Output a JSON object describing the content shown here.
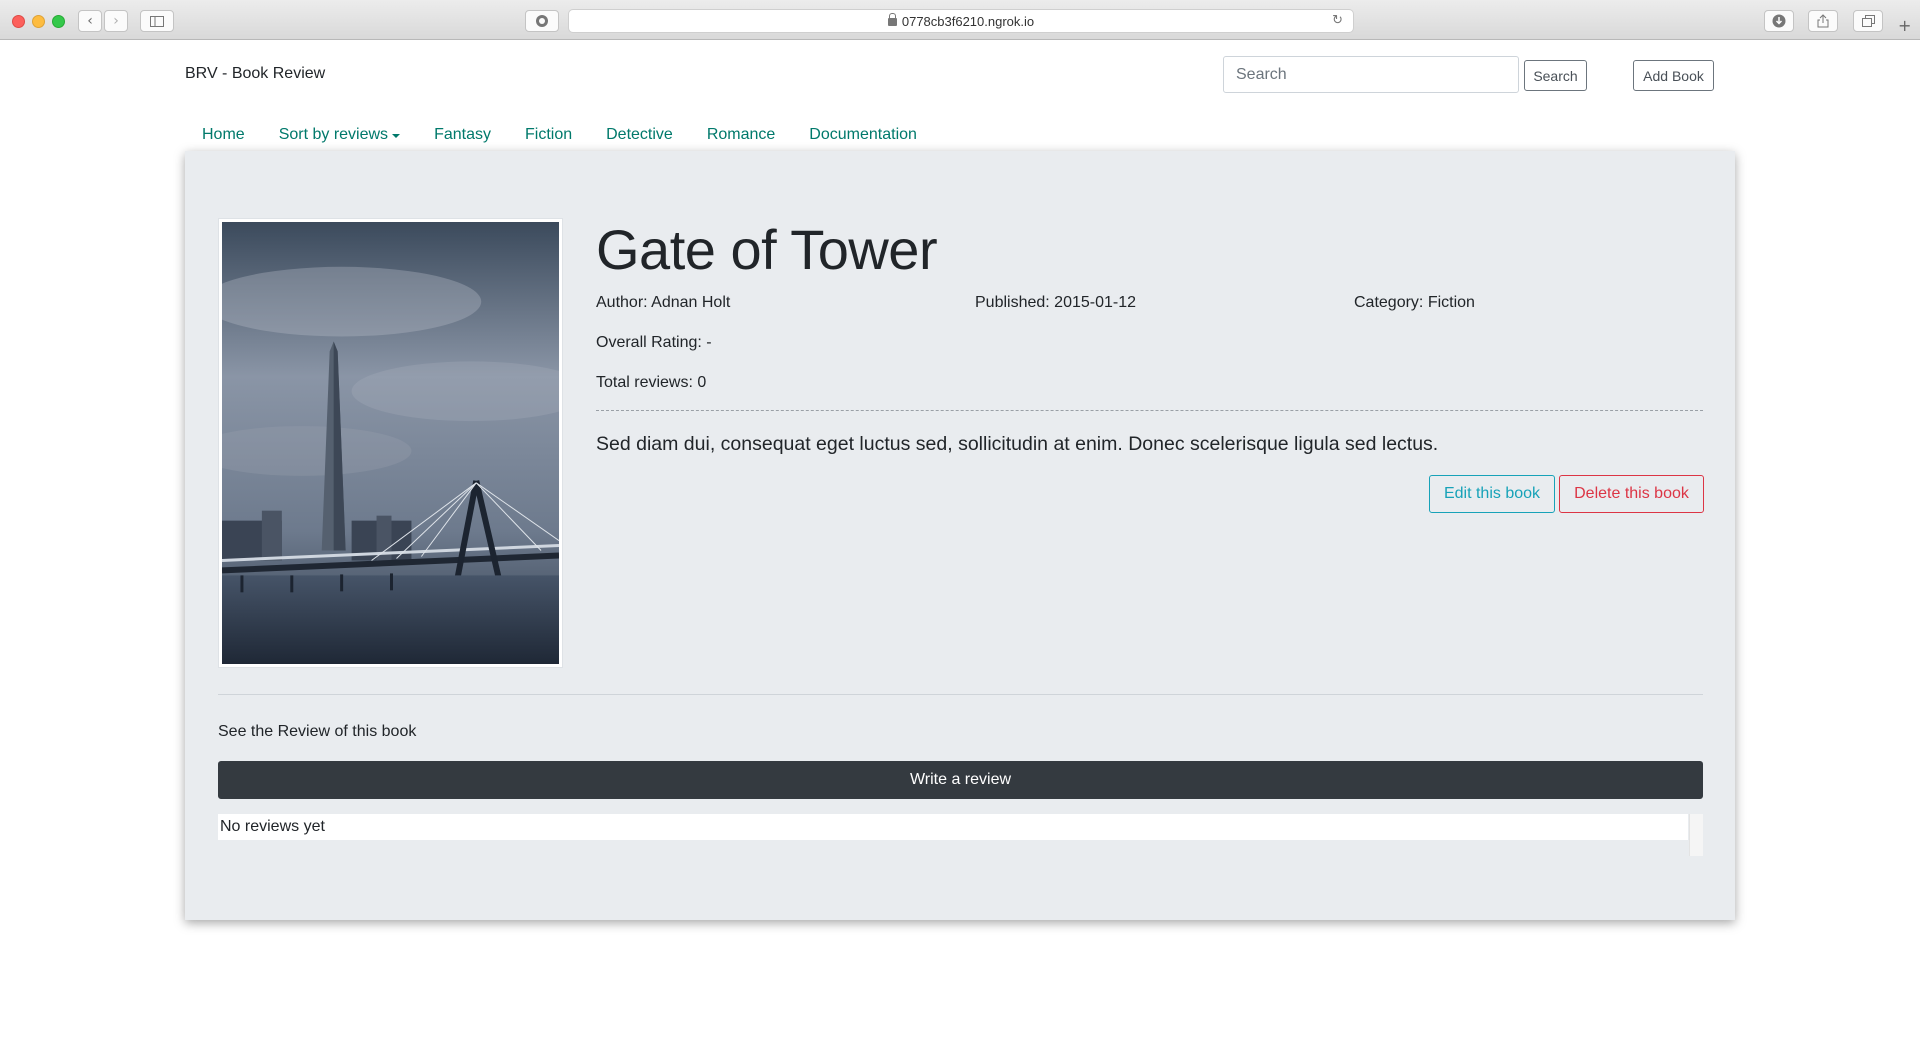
{
  "browser": {
    "url": "0778cb3f6210.ngrok.io",
    "icons": [
      "back-icon",
      "forward-icon",
      "sidebar-icon",
      "reader-icon",
      "reload-icon",
      "download-icon",
      "share-icon",
      "tabs-icon",
      "new-tab-icon"
    ]
  },
  "navbar": {
    "brand": "BRV - Book Review",
    "search_placeholder": "Search",
    "search_label": "Search",
    "add_book_label": "Add Book",
    "links": [
      "Home",
      "Sort by reviews",
      "Fantasy",
      "Fiction",
      "Detective",
      "Romance",
      "Documentation"
    ]
  },
  "book": {
    "title": "Gate of Tower",
    "author": "Author: Adnan Holt",
    "published": "Published: 2015-01-12",
    "category": "Category: Fiction",
    "overall_rating": "Overall Rating: -",
    "total_reviews": "Total reviews: 0",
    "description": "Sed diam dui, consequat eget luctus sed, sollicitudin at enim. Donec scelerisque ligula sed lectus.",
    "edit_label": "Edit this book",
    "delete_label": "Delete this book"
  },
  "reviews": {
    "heading": "See the Review of this book",
    "write_label": "Write a review",
    "empty_text": "No reviews yet"
  },
  "colors": {
    "nav_link": "#00796b",
    "card_bg": "#e9ecef",
    "edit": "#17a2b8",
    "delete": "#dc3545",
    "write_btn": "#343a40"
  }
}
